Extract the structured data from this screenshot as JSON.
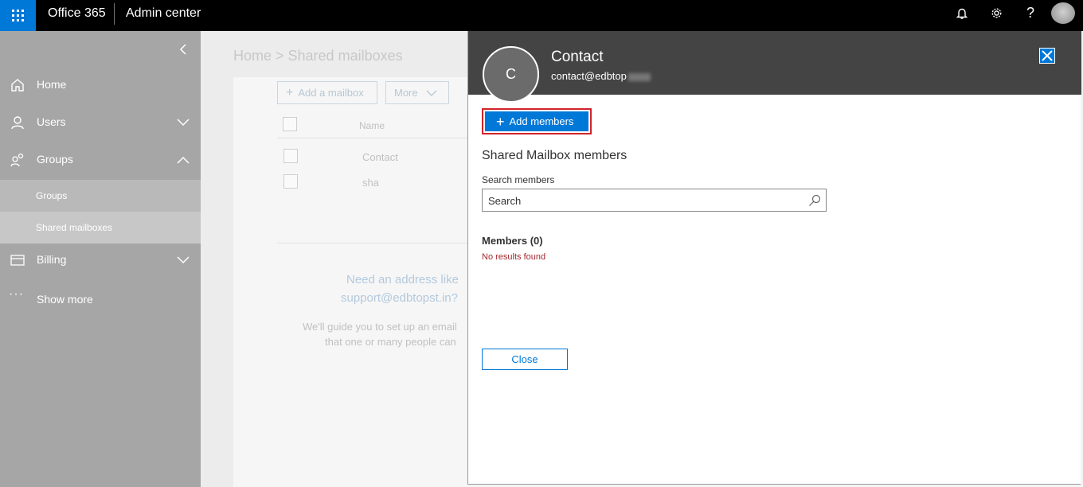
{
  "topbar": {
    "app_name": "Office 365",
    "suite_title": "Admin center",
    "icons": [
      "waffle-icon",
      "bell-icon",
      "gear-icon",
      "help-icon",
      "user-avatar"
    ],
    "help_glyph": "?"
  },
  "sidebar": {
    "items": [
      {
        "label": "Home",
        "icon": "home-icon"
      },
      {
        "label": "Users",
        "icon": "user-icon"
      },
      {
        "label": "Groups",
        "icon": "groups-icon"
      },
      {
        "label": "Billing",
        "icon": "billing-icon"
      },
      {
        "label": "Show more",
        "icon": "ellipsis-icon"
      }
    ],
    "groups_sub": [
      {
        "label": "Groups"
      },
      {
        "label": "Shared mailboxes",
        "active": true
      }
    ],
    "more_glyph": "···"
  },
  "main": {
    "breadcrumb": "Home > Shared mailboxes",
    "add_button": "Add a mailbox",
    "more_button": "More",
    "column_name": "Name",
    "rows": [
      "Contact",
      "sha"
    ],
    "empty_title_line1": "Need an address like",
    "empty_title_line2": "support@edbtopst.in?",
    "empty_body_line1": "We'll guide you to set up an email",
    "empty_body_line2": "that one or many people can"
  },
  "panel": {
    "avatar_initial": "C",
    "contact_name": "Contact",
    "contact_email": "contact@edbtop",
    "add_members": "Add members",
    "section_title": "Shared Mailbox members",
    "search_label": "Search members",
    "search_placeholder": "Search",
    "members_title": "Members (0)",
    "no_results": "No results found",
    "close_button": "Close"
  },
  "colors": {
    "accent": "#0078d7",
    "topbar": "#000000",
    "panel_header": "#444444",
    "highlight_outline": "#d2232a",
    "error_text": "#a4262c"
  }
}
